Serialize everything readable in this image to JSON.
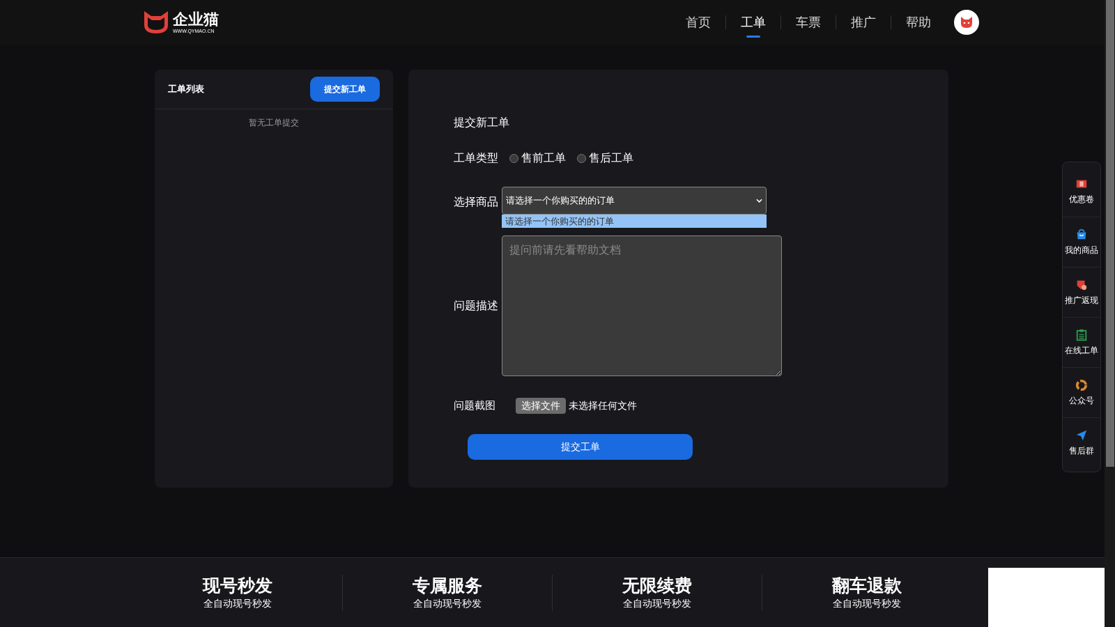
{
  "header": {
    "logo": {
      "name": "企业猫",
      "url": "WWW.QYMAO.CN"
    },
    "nav": [
      {
        "label": "首页",
        "selected": false
      },
      {
        "label": "工单",
        "selected": true
      },
      {
        "label": "车票",
        "selected": false
      },
      {
        "label": "推广",
        "selected": false
      },
      {
        "label": "帮助",
        "selected": false
      }
    ]
  },
  "ticket_list": {
    "title": "工单列表",
    "new_button": "提交新工单",
    "empty": "暂无工单提交"
  },
  "form": {
    "title": "提交新工单",
    "type": {
      "label": "工单类型",
      "options": [
        {
          "label": "售前工单",
          "selected": false
        },
        {
          "label": "售后工单",
          "selected": false
        }
      ]
    },
    "product": {
      "label": "选择商品",
      "value": "请选择一个你购买的的订单",
      "options": [
        {
          "label": "请选择一个你购买的的订单",
          "selected": true
        }
      ]
    },
    "description": {
      "label": "问题描述",
      "placeholder": "提问前请先看帮助文档"
    },
    "screenshot": {
      "label": "问题截图",
      "button": "选择文件",
      "status": "未选择任何文件"
    },
    "submit": "提交工单"
  },
  "side_bar": [
    {
      "kind": "coupon",
      "label": "优惠卷"
    },
    {
      "kind": "bag",
      "label": "我的商品"
    },
    {
      "kind": "rebate",
      "label": "推广返现"
    },
    {
      "kind": "clipboard",
      "label": "在线工单"
    },
    {
      "kind": "swirl",
      "label": "公众号"
    },
    {
      "kind": "plane",
      "label": "售后群"
    }
  ],
  "features": [
    {
      "title": "现号秒发",
      "subtitle": "全自动现号秒发"
    },
    {
      "title": "专属服务",
      "subtitle": "全自动现号秒发"
    },
    {
      "title": "无限续费",
      "subtitle": "全自动现号秒发"
    },
    {
      "title": "翻车退款",
      "subtitle": "全自动现号秒发"
    }
  ]
}
